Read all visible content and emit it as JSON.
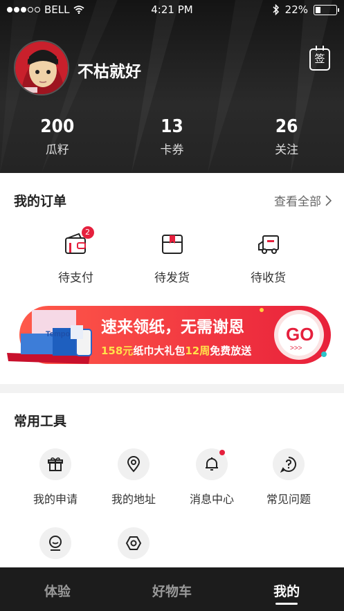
{
  "status_bar": {
    "carrier": "BELL",
    "time": "4:21 PM",
    "battery": "22%",
    "battery_level": 0.22
  },
  "profile": {
    "username": "不枯就好",
    "signin_label": "签"
  },
  "stats": [
    {
      "value": "200",
      "label": "瓜籽"
    },
    {
      "value": "13",
      "label": "卡券"
    },
    {
      "value": "26",
      "label": "关注"
    }
  ],
  "orders": {
    "title": "我的订单",
    "see_all": "查看全部",
    "items": [
      {
        "label": "待支付",
        "icon": "wallet-icon",
        "badge": "2"
      },
      {
        "label": "待发货",
        "icon": "package-icon"
      },
      {
        "label": "待收货",
        "icon": "truck-icon"
      }
    ]
  },
  "banner": {
    "headline": "速来领纸，无需谢恩",
    "sub_pre": "158元",
    "sub_mid": "纸巾大礼包",
    "sub_weeks": "12周",
    "sub_post": "免费放送",
    "go": "GO",
    "brand": "Tempo"
  },
  "tools": {
    "title": "常用工具",
    "items": [
      {
        "label": "我的申请",
        "icon": "gift-icon"
      },
      {
        "label": "我的地址",
        "icon": "location-icon"
      },
      {
        "label": "消息中心",
        "icon": "bell-icon"
      },
      {
        "label": "常见问题",
        "icon": "question-icon"
      },
      {
        "label": "",
        "icon": "service-icon"
      },
      {
        "label": "",
        "icon": "settings-icon"
      }
    ]
  },
  "tabbar": [
    {
      "label": "体验"
    },
    {
      "label": "好物车"
    },
    {
      "label": "我的"
    }
  ],
  "colors": {
    "accent": "#e5203d",
    "dark": "#1c1c1c"
  }
}
